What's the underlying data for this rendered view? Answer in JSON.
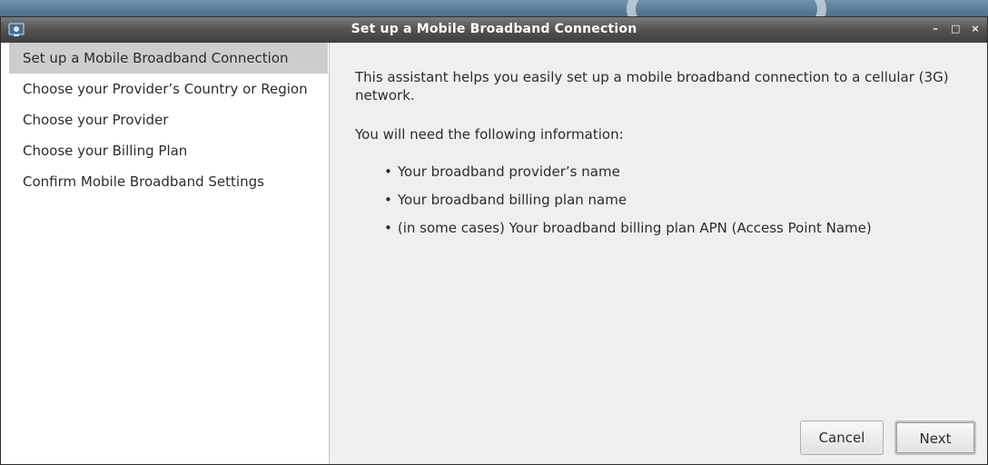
{
  "window": {
    "title": "Set up a Mobile Broadband Connection",
    "controls": {
      "minimize": "–",
      "maximize": "□",
      "close": "×"
    }
  },
  "sidebar": {
    "items": [
      {
        "label": "Set up a Mobile Broadband Connection",
        "active": true
      },
      {
        "label": "Choose your Provider’s Country or Region",
        "active": false
      },
      {
        "label": "Choose your Provider",
        "active": false
      },
      {
        "label": "Choose your Billing Plan",
        "active": false
      },
      {
        "label": "Confirm Mobile Broadband Settings",
        "active": false
      }
    ]
  },
  "content": {
    "intro": "This assistant helps you easily set up a mobile broadband connection to a cellular (3G) network.",
    "need_heading": "You will need the following information:",
    "bullets": [
      "Your broadband provider’s name",
      "Your broadband billing plan name",
      "(in some cases) Your broadband billing plan APN (Access Point Name)"
    ],
    "bullet_glyph": "•"
  },
  "buttons": {
    "cancel": "Cancel",
    "next": "Next"
  },
  "icons": {
    "app": "network-app-icon"
  },
  "colors": {
    "titlebar": "#4a4a4a",
    "sidebar_active": "#cdcdcd",
    "content_bg": "#efefef"
  }
}
